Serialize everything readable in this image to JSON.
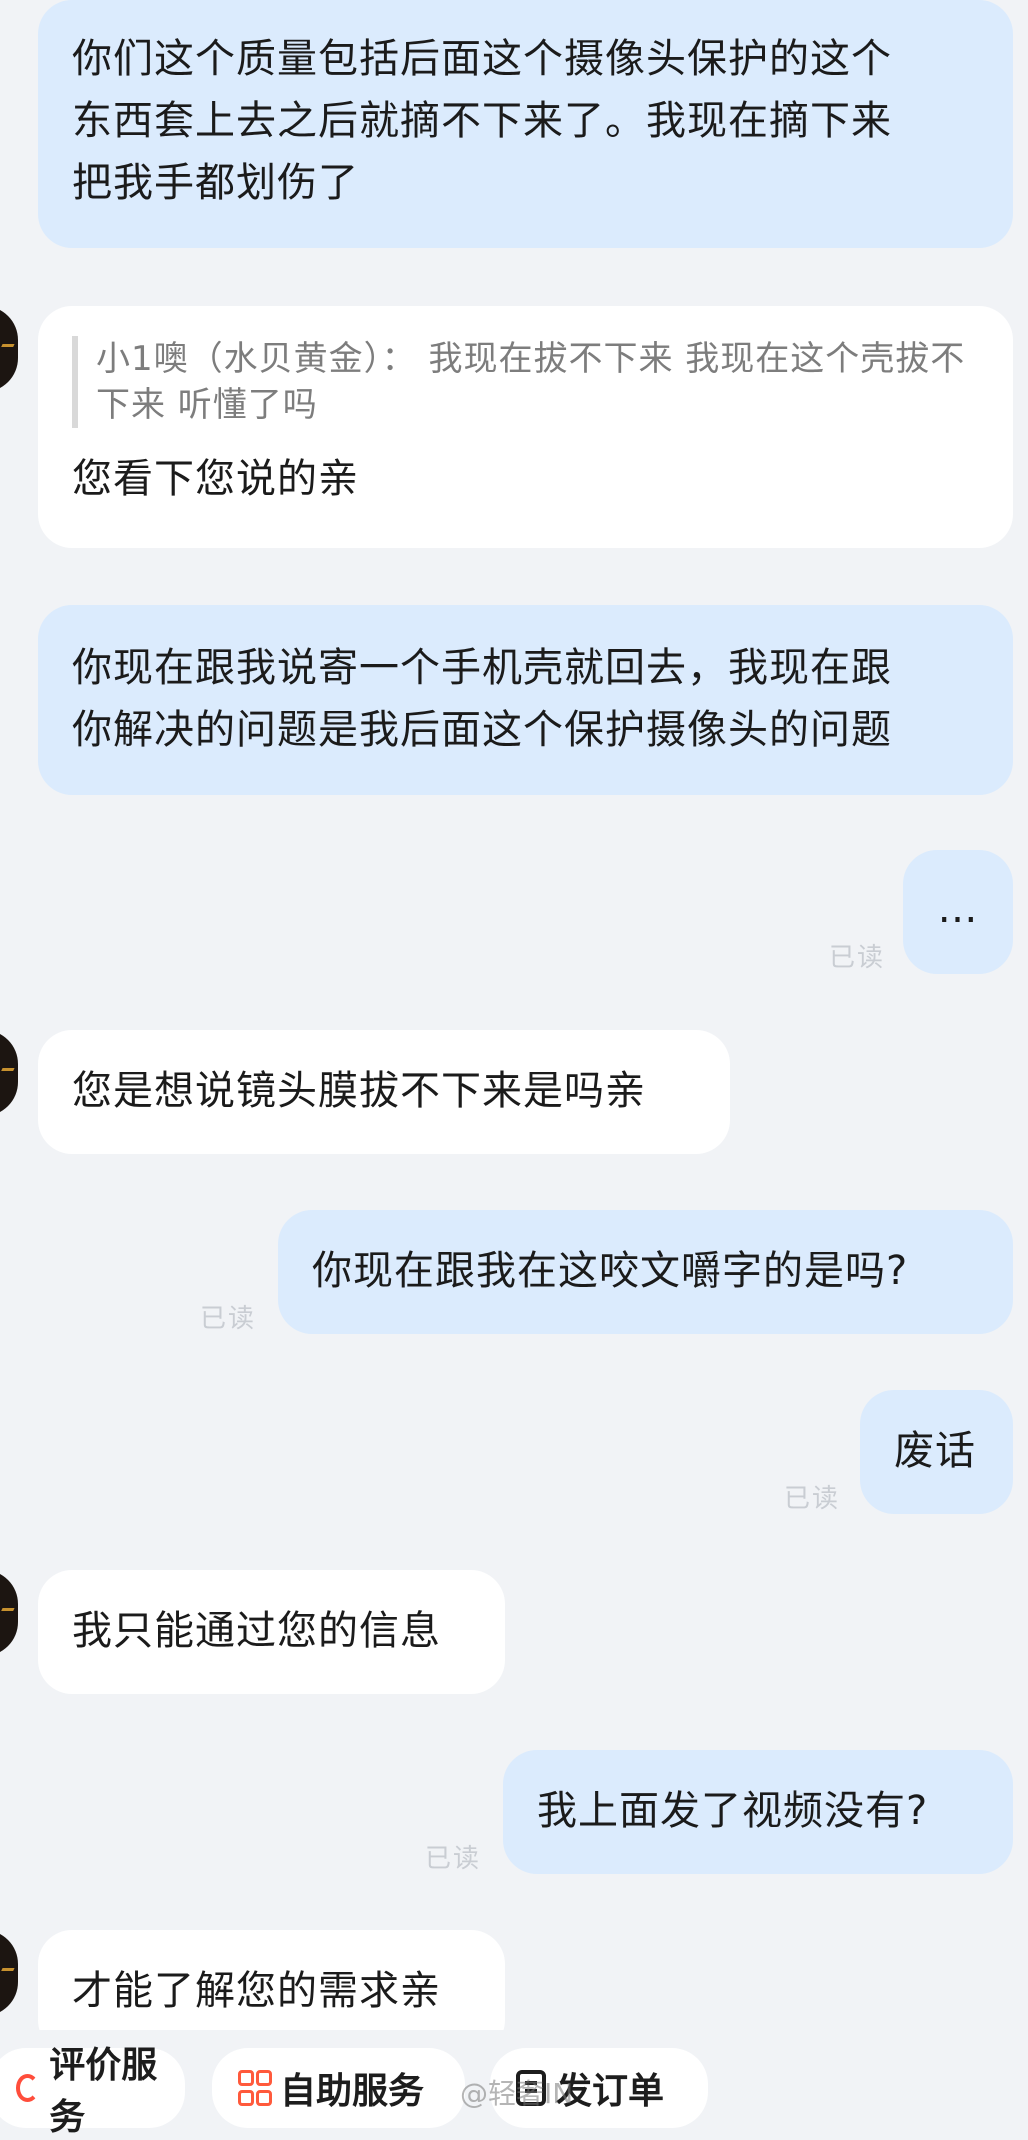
{
  "messages": [
    {
      "side": "out",
      "text": "你们这个质量包括后面这个摄像头保护的这个\n东西套上去之后就摘不下来了。我现在摘下来\n把我手都划伤了"
    },
    {
      "side": "in",
      "quote": "小1噢（水贝黄金）： 我现在拔不下来 我现在这个壳拔不下来 听懂了吗",
      "text": "您看下您说的亲"
    },
    {
      "side": "out",
      "text": "你现在跟我说寄一个手机壳就回去，我现在跟\n你解决的问题是我后面这个保护摄像头的问题"
    },
    {
      "side": "out",
      "text": "…",
      "status": "已读"
    },
    {
      "side": "in",
      "text": "您是想说镜头膜拔不下来是吗亲"
    },
    {
      "side": "out",
      "text": "你现在跟我在这咬文嚼字的是吗?",
      "status": "已读"
    },
    {
      "side": "out",
      "text": "废话",
      "status": "已读"
    },
    {
      "side": "in",
      "text": "我只能通过您的信息"
    },
    {
      "side": "out",
      "text": "我上面发了视频没有?",
      "status": "已读"
    },
    {
      "side": "in",
      "text": "才能了解您的需求亲"
    }
  ],
  "toolbar": {
    "rate": "评价服务",
    "self_service": "自助服务",
    "order": "发订单"
  },
  "watermark": "@轻奢IN"
}
